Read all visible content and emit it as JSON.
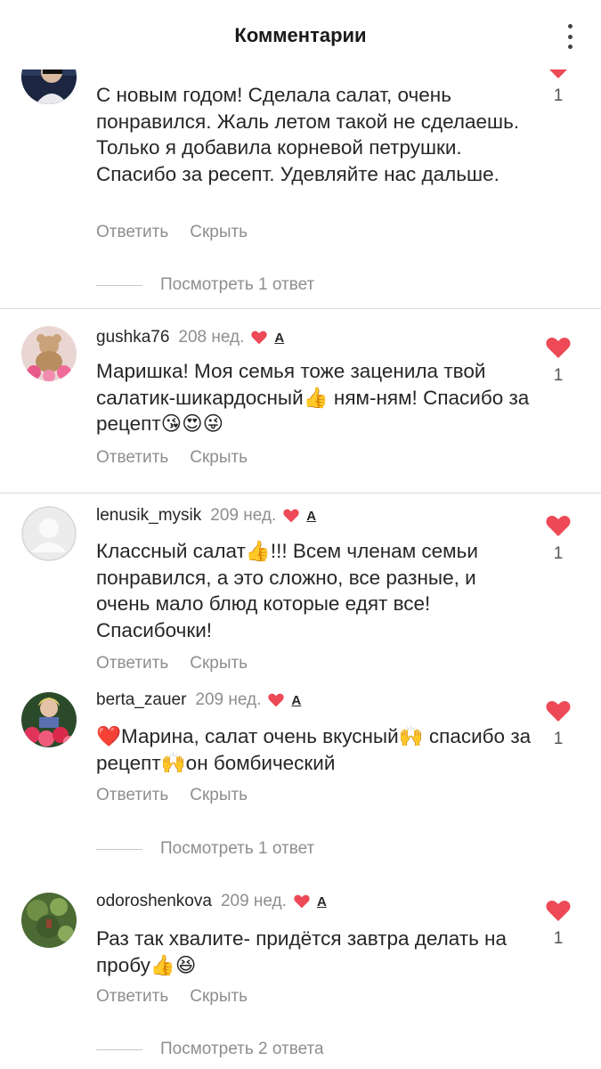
{
  "header": {
    "title": "Комментарии"
  },
  "actions": {
    "reply": "Ответить",
    "hide": "Скрыть"
  },
  "comments": [
    {
      "username": "",
      "time": "",
      "text": "С новым годом! Сделала салат, очень понравился. Жаль летом такой не сделаешь. Только я добавила корневой петрушки. Спасибо за ресепт. Удевляйте нас дальше.",
      "likes": "1",
      "view_replies": "Посмотреть 1 ответ"
    },
    {
      "username": "gushka76",
      "time": "208 нед.",
      "text": "Маришка! Моя семья тоже заценила твой салатик-шикардосный👍 ням-ням! Спасибо за рецепт😘😍😜",
      "likes": "1"
    },
    {
      "username": "lenusik_mysik",
      "time": "209 нед.",
      "text": "Классный салат👍!!! Всем членам семьи понравился, а это сложно, все разные, и очень мало блюд которые едят все! Спасибочки!",
      "likes": "1"
    },
    {
      "username": "berta_zauer",
      "time": "209 нед.",
      "text": "❤️Марина, салат очень вкусный🙌 спасибо за рецепт🙌он бомбический",
      "likes": "1",
      "view_replies": "Посмотреть 1 ответ"
    },
    {
      "username": "odoroshenkova",
      "time": "209 нед.",
      "text": "Раз так хвалите- придётся завтра делать на пробу👍😆",
      "likes": "1",
      "view_replies": "Посмотреть 2 ответа"
    }
  ],
  "colors": {
    "heart": "#ed4956",
    "secondary_text": "#8e8e8e",
    "primary_text": "#262626",
    "separator": "#dbdbdb"
  },
  "icons": {
    "like": "heart-icon",
    "author_liked": "heart-small-icon",
    "pinned": "pin-icon",
    "more": "more-vertical-icon"
  }
}
